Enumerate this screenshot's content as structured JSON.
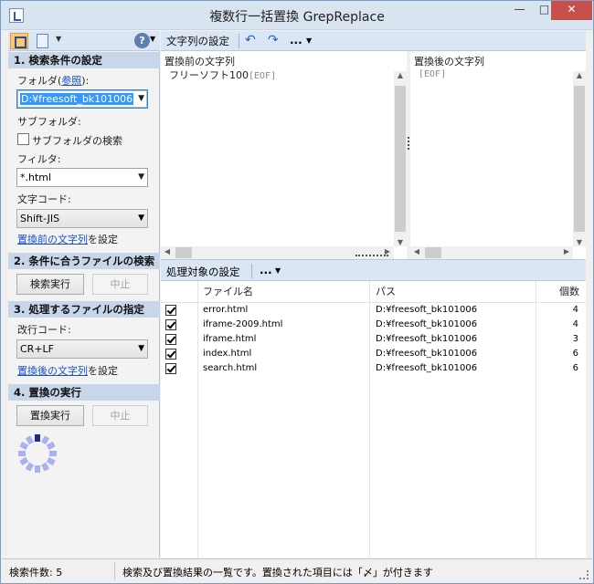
{
  "window": {
    "title": "複数行一括置換 GrepReplace",
    "min": "—",
    "max": "□",
    "close": "✕"
  },
  "sidebar": {
    "sec1": "1. 検索条件の設定",
    "folder_label": "フォルダ(",
    "folder_link": "参照",
    "folder_label_end": "):",
    "folder_value": "D:¥freesoft_bk101006",
    "subfolder_label": "サブフォルダ:",
    "subfolder_check": "サブフォルダの検索",
    "filter_label": "フィルタ:",
    "filter_value": "*.html",
    "encoding_label": "文字コード:",
    "encoding_value": "Shift-JIS",
    "before_link": "置換前の文字列",
    "before_suffix": "を設定",
    "sec2": "2. 条件に合うファイルの検索",
    "search_btn": "検索実行",
    "stop_btn": "中止",
    "sec3": "3. 処理するファイルの指定",
    "newline_label": "改行コード:",
    "newline_value": "CR+LF",
    "after_link": "置換後の文字列",
    "after_suffix": "を設定",
    "sec4": "4. 置換の実行",
    "replace_btn": "置換実行",
    "stop_btn2": "中止"
  },
  "toolbar": {
    "strings_title": "文字列の設定",
    "more": "...",
    "targets_title": "処理対象の設定"
  },
  "panes": {
    "before_title": "置換前の文字列",
    "before_text": "フリーソフト100",
    "before_eof": "[EOF]",
    "after_title": "置換後の文字列",
    "after_eof": "[EOF]"
  },
  "grid": {
    "columns": [
      "ファイル名",
      "パス",
      "個数"
    ],
    "rows": [
      {
        "name": "error.html",
        "path": "D:¥freesoft_bk101006",
        "count": "4"
      },
      {
        "name": "iframe-2009.html",
        "path": "D:¥freesoft_bk101006",
        "count": "4"
      },
      {
        "name": "iframe.html",
        "path": "D:¥freesoft_bk101006",
        "count": "3"
      },
      {
        "name": "index.html",
        "path": "D:¥freesoft_bk101006",
        "count": "6"
      },
      {
        "name": "search.html",
        "path": "D:¥freesoft_bk101006",
        "count": "6"
      }
    ]
  },
  "status": {
    "count": "検索件数: 5",
    "message": "検索及び置換結果の一覧です。置換された項目には「〆」が付きます"
  },
  "colors": {
    "accent": "#dbe6f4",
    "section": "#c8d6ea",
    "link": "#1a4fd0",
    "close": "#c7504a"
  }
}
